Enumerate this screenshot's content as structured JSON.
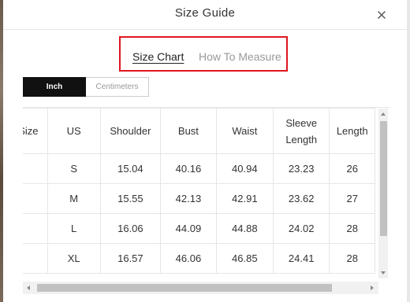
{
  "modal": {
    "title": "Size Guide",
    "close_icon": "close-icon"
  },
  "tabs": [
    {
      "label": "Size Chart",
      "active": true
    },
    {
      "label": "How To Measure",
      "active": false
    }
  ],
  "highlight_color": "#e0161e",
  "units": [
    {
      "label": "Inch",
      "active": true
    },
    {
      "label": "Centimeters",
      "active": false
    }
  ],
  "table": {
    "headers": [
      "Size",
      "US",
      "Shoulder",
      "Bust",
      "Waist",
      "Sleeve Length",
      "Length"
    ],
    "rows": [
      {
        "size": "",
        "us": "S",
        "shoulder": "15.04",
        "bust": "40.16",
        "waist": "40.94",
        "sleeve": "23.23",
        "length": "26"
      },
      {
        "size": "",
        "us": "M",
        "shoulder": "15.55",
        "bust": "42.13",
        "waist": "42.91",
        "sleeve": "23.62",
        "length": "27"
      },
      {
        "size": "",
        "us": "L",
        "shoulder": "16.06",
        "bust": "44.09",
        "waist": "44.88",
        "sleeve": "24.02",
        "length": "28"
      },
      {
        "size": "",
        "us": "XL",
        "shoulder": "16.57",
        "bust": "46.06",
        "waist": "46.85",
        "sleeve": "24.41",
        "length": "28"
      }
    ]
  }
}
